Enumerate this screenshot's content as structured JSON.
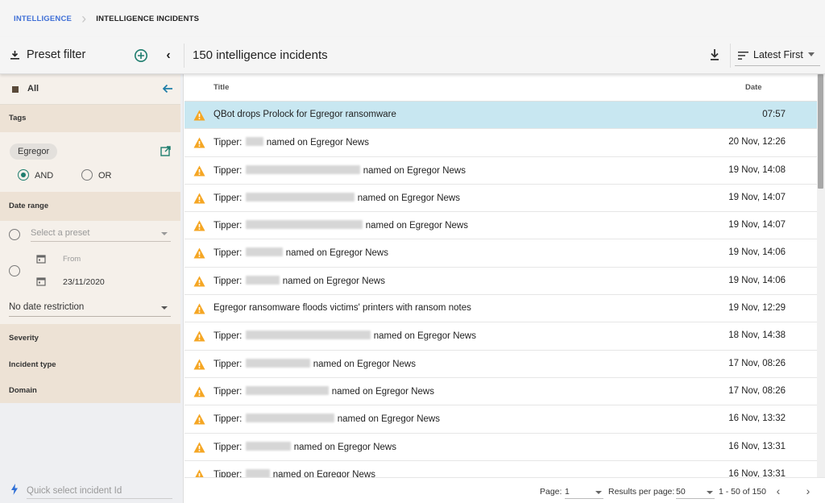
{
  "breadcrumb": {
    "root": "INTELLIGENCE",
    "current": "INTELLIGENCE INCIDENTS"
  },
  "toolbar": {
    "preset_filter_label": "Preset filter",
    "title": "150 intelligence incidents",
    "sort_label": "Latest First"
  },
  "sidebar": {
    "all_label": "All",
    "tags_header": "Tags",
    "tag_chip": "Egregor",
    "and_label": "AND",
    "or_label": "OR",
    "date_range_header": "Date range",
    "preset_placeholder": "Select a preset",
    "from_label": "From",
    "date_value": "23/11/2020",
    "no_date_label": "No date restriction",
    "severity_header": "Severity",
    "incident_type_header": "Incident type",
    "domain_header": "Domain",
    "quick_select_placeholder": "Quick select incident Id"
  },
  "table": {
    "col_title": "Title",
    "col_date": "Date",
    "rows": [
      {
        "prefix": "QBot drops Prolock for Egregor ransomware",
        "blur": 0,
        "suffix": "",
        "date": "07:57",
        "selected": true
      },
      {
        "prefix": "Tipper: ",
        "blur": 22,
        "suffix": " named on Egregor News",
        "date": "20 Nov, 12:26",
        "selected": false
      },
      {
        "prefix": "Tipper: ",
        "blur": 142,
        "suffix": " named on Egregor News",
        "date": "19 Nov, 14:08",
        "selected": false
      },
      {
        "prefix": "Tipper: ",
        "blur": 135,
        "suffix": " named on Egregor News",
        "date": "19 Nov, 14:07",
        "selected": false
      },
      {
        "prefix": "Tipper: ",
        "blur": 145,
        "suffix": " named on Egregor News",
        "date": "19 Nov, 14:07",
        "selected": false
      },
      {
        "prefix": "Tipper: ",
        "blur": 46,
        "suffix": " named on Egregor News",
        "date": "19 Nov, 14:06",
        "selected": false
      },
      {
        "prefix": "Tipper: ",
        "blur": 42,
        "suffix": " named on Egregor News",
        "date": "19 Nov, 14:06",
        "selected": false
      },
      {
        "prefix": "Egregor ransomware floods victims' printers with ransom notes",
        "blur": 0,
        "suffix": "",
        "date": "19 Nov, 12:29",
        "selected": false
      },
      {
        "prefix": "Tipper: ",
        "blur": 155,
        "suffix": " named on Egregor News",
        "date": "18 Nov, 14:38",
        "selected": false
      },
      {
        "prefix": "Tipper: ",
        "blur": 80,
        "suffix": " named on Egregor News",
        "date": "17 Nov, 08:26",
        "selected": false
      },
      {
        "prefix": "Tipper: ",
        "blur": 103,
        "suffix": " named on Egregor News",
        "date": "17 Nov, 08:26",
        "selected": false
      },
      {
        "prefix": "Tipper: ",
        "blur": 110,
        "suffix": " named on Egregor News",
        "date": "16 Nov, 13:32",
        "selected": false
      },
      {
        "prefix": "Tipper: ",
        "blur": 56,
        "suffix": " named on Egregor News",
        "date": "16 Nov, 13:31",
        "selected": false
      },
      {
        "prefix": "Tipper: ",
        "blur": 30,
        "suffix": " named on Egregor News",
        "date": "16 Nov, 13:31",
        "selected": false
      }
    ]
  },
  "footer": {
    "page_label": "Page:",
    "page_value": "1",
    "rpp_label": "Results per page:",
    "rpp_value": "50",
    "range_label": "1 - 50 of 150"
  },
  "colors": {
    "accent_teal": "#1e7d6e",
    "link_blue": "#3f6fd6",
    "warning": "#f5a623",
    "selected_row": "#c8e7f1",
    "filter_panel": "#f5f0ea"
  }
}
